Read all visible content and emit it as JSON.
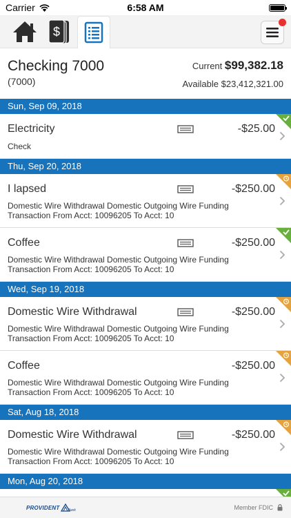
{
  "status_bar": {
    "carrier": "Carrier",
    "time": "6:58 AM"
  },
  "nav": {
    "tabs": [
      {
        "name": "home",
        "icon": "home-icon"
      },
      {
        "name": "money",
        "icon": "cash-icon"
      },
      {
        "name": "accounts",
        "icon": "document-list-icon",
        "active": true
      }
    ],
    "menu_icon": "hamburger-menu-icon",
    "notification_color": "#e8312f"
  },
  "account": {
    "name": "Checking 7000",
    "number": "(7000)",
    "current_label": "Current",
    "current_balance": "$99,382.18",
    "available_label": "Available",
    "available_balance": "$23,412,321.00"
  },
  "colors": {
    "accent": "#1873bd",
    "cleared": "#66b03b",
    "pending": "#e6a23c"
  },
  "transactions": {
    "g0": {
      "date": "Sun, Sep 09, 2018",
      "t0": {
        "title": "Electricity",
        "amount": "-$25.00",
        "desc1": "Check",
        "desc2": "",
        "status": "cleared"
      }
    },
    "g1": {
      "date": "Thu, Sep 20, 2018",
      "t0": {
        "title": "I lapsed",
        "amount": "-$250.00",
        "desc1": "Domestic Wire Withdrawal  Domestic Outgoing Wire Funding",
        "desc2": "Transaction From Acct: 10096205 To Acct: 10",
        "status": "pending"
      },
      "t1": {
        "title": "Coffee",
        "amount": "-$250.00",
        "desc1": "Domestic Wire Withdrawal  Domestic Outgoing Wire Funding",
        "desc2": "Transaction From Acct: 10096205 To Acct: 10",
        "status": "cleared"
      }
    },
    "g2": {
      "date": "Wed, Sep 19, 2018",
      "t0": {
        "title": "Domestic Wire Withdrawal",
        "amount": "-$250.00",
        "desc1": "Domestic Wire Withdrawal  Domestic Outgoing Wire Funding",
        "desc2": "Transaction From Acct: 10096205 To Acct: 10",
        "status": "pending"
      },
      "t1": {
        "title": "Coffee",
        "amount": "-$250.00",
        "desc1": "Domestic Wire Withdrawal  Domestic Outgoing Wire Funding",
        "desc2": "Transaction From Acct: 10096205 To Acct: 10",
        "status": "pending"
      }
    },
    "g3": {
      "date": "Sat, Aug 18, 2018",
      "t0": {
        "title": "Domestic Wire Withdrawal",
        "amount": "-$250.00",
        "desc1": "Domestic Wire Withdrawal  Domestic Outgoing Wire Funding",
        "desc2": "Transaction From Acct: 10096205 To Acct: 10",
        "status": "pending"
      }
    },
    "g4": {
      "date": "Mon, Aug 20, 2018",
      "t0": {
        "status": "cleared"
      }
    }
  },
  "footer": {
    "logo_text": "PROVIDENT",
    "logo_sub": "Bank",
    "member_text": "Member FDIC",
    "lock_icon": "lock-icon"
  }
}
